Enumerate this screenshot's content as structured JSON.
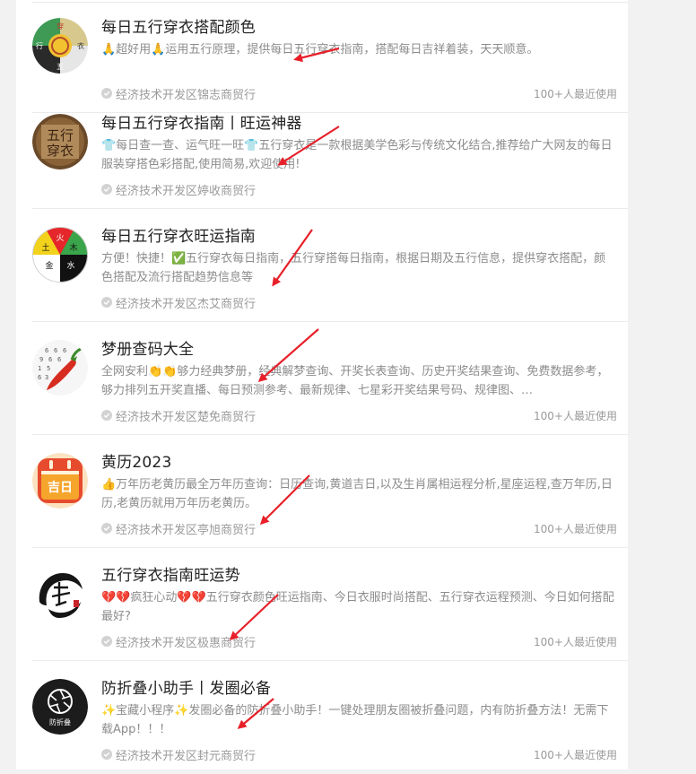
{
  "items": [
    {
      "title": "每日五行穿衣搭配颜色",
      "desc": "🙏超好用🙏运用五行原理，提供每日五行穿衣指南，搭配每日吉祥着装，天天顺意。",
      "company": "经济技术开发区锦志商贸行",
      "usage": "100+人最近使用",
      "logo_icon": "five-elements-emblem-icon"
    },
    {
      "title": "每日五行穿衣指南丨旺运神器",
      "desc": "👕每日查一查、运气旺一旺👕五行穿衣是一款根据美学色彩与传统文化结合,推荐给广大网友的每日服装穿搭色彩搭配,使用简易,欢迎使用!",
      "company": "经济技术开发区婷收商贸行",
      "usage": "",
      "logo_icon": "wuxing-chuanyi-seal-icon"
    },
    {
      "title": "每日五行穿衣旺运指南",
      "desc": "方便！快捷！✅五行穿衣每日指南，五行穿搭每日指南，根据日期及五行信息，提供穿衣搭配，颜色搭配及流行搭配趋势信息等",
      "company": "经济技术开发区杰艾商贸行",
      "usage": "",
      "logo_icon": "five-elements-quadrant-icon",
      "quadrant": [
        "火",
        "木",
        "土",
        "金",
        "水"
      ]
    },
    {
      "title": "梦册查码大全",
      "desc": "全网安利👏👏够力经典梦册，经典解梦查询、开奖长表查询、历史开奖结果查询、免费数据参考，够力排列五开奖直播、每日预测参考、最新规律、七星彩开奖结果号码、规律图、…",
      "company": "经济技术开发区楚免商贸行",
      "usage": "100+人最近使用",
      "logo_icon": "lottery-pepper-icon"
    },
    {
      "title": "黄历2023",
      "desc": "👍万年历老黄历最全万年历查询：日历查询,黄道吉日,以及生肖属相运程分析,星座运程,查万年历,日历,老黄历就用万年历老黄历。",
      "company": "经济技术开发区亭旭商贸行",
      "usage": "100+人最近使用",
      "logo_icon": "calendar-icon",
      "logo_text": "吉日"
    },
    {
      "title": "五行穿衣指南旺运势",
      "desc": "💔💔疯狂心动💔💔五行穿衣颜色旺运指南、今日衣服时尚搭配、五行穿衣运程预测、今日如何搭配最好?",
      "company": "经济技术开发区极惠商贸行",
      "usage": "100+人最近使用",
      "logo_icon": "ink-calligraphy-icon"
    },
    {
      "title": "防折叠小助手丨发圈必备",
      "desc": "✨宝藏小程序✨发圈必备的防折叠小助手！一键处理朋友圈被折叠问题，内有防折叠方法！无需下载App！！！",
      "company": "经济技术开发区封元商贸行",
      "usage": "100+人最近使用",
      "logo_icon": "camera-aperture-icon",
      "logo_text": "防折叠"
    }
  ],
  "colors": {
    "annotation_arrow": "#e8202a",
    "title": "#222222",
    "secondary": "#9a9a9a"
  }
}
